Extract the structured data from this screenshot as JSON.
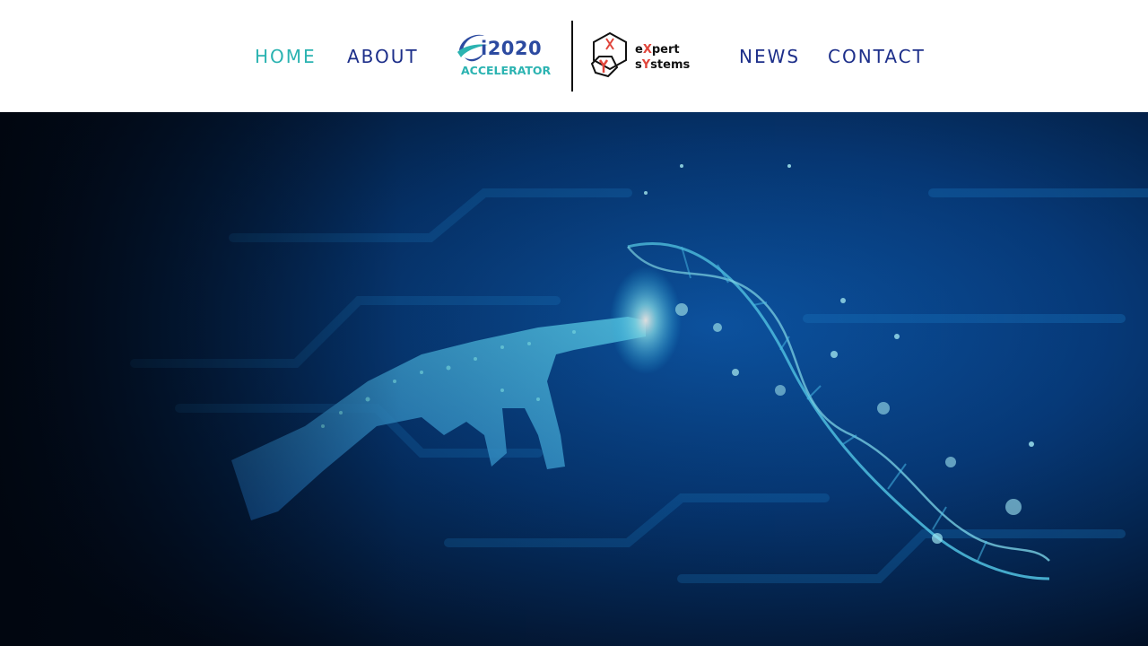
{
  "nav": {
    "home": "HOME",
    "about": "ABOUT",
    "news": "NEWS",
    "contact": "CONTACT"
  },
  "logos": {
    "i2020": {
      "main": "i2020",
      "sub": "ACCELERATOR"
    },
    "expert": {
      "pre1": "e",
      "hl1": "X",
      "rest1": "pert",
      "pre2": "s",
      "hl2": "Y",
      "rest2": "stems"
    }
  },
  "colors": {
    "nav_active": "#2bb3b1",
    "nav_default": "#1d2f8a",
    "i2020_blue": "#2c4aa0",
    "accelerator_teal": "#2bb3b1",
    "expert_red": "#e0453b",
    "divider": "#111111",
    "hero_dark": "#020b1c",
    "hero_glow": "#29c4ff"
  },
  "hero": {
    "image_icons": [
      "robot-hand-icon",
      "dna-helix-icon"
    ]
  }
}
